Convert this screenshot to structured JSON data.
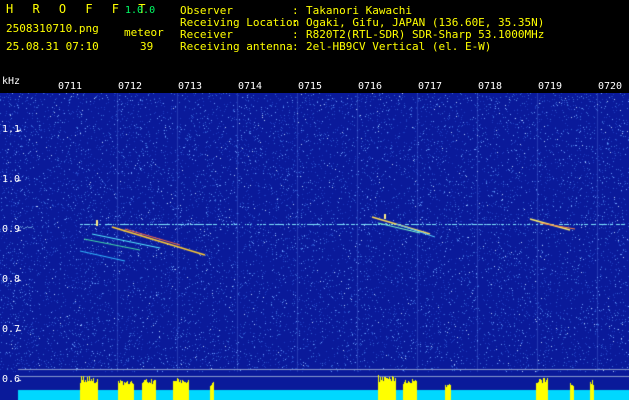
{
  "header": {
    "app_title": "H R O F F T",
    "app_version": "1.0.0",
    "filename": "2508310710.png",
    "datetime": "25.08.31 07:10",
    "meteor_label": "meteor",
    "meteor_count": "39",
    "info": [
      {
        "label": "Observer",
        "value": "Takanori Kawachi"
      },
      {
        "label": "Receiving Location",
        "value": "Ogaki, Gifu, JAPAN (136.60E, 35.35N)"
      },
      {
        "label": "Receiver",
        "value": "R820T2(RTL-SDR) SDR-Sharp 53.1000MHz"
      },
      {
        "label": "Receiving antenna",
        "value": "2el-HB9CV Vertical (el. E-W)"
      }
    ],
    "colon": ":"
  },
  "axis": {
    "y_unit": "kHz",
    "y_labels": [
      "1.1",
      "1.0",
      "0.9",
      "0.8",
      "0.7",
      "0.6"
    ],
    "time_labels": [
      "0711",
      "0712",
      "0713",
      "0714",
      "0715",
      "0716",
      "0717",
      "0718",
      "0719",
      "0720"
    ]
  },
  "colors": {
    "background": "#0a1a9a",
    "noise": "#3a6bd8",
    "trail": "#ffe85a",
    "carrier": "#7ee6ff",
    "text_yellow": "#ffff00",
    "text_white": "#ffffff",
    "text_green": "#00ff66",
    "bottom_bar": "#00d8ff",
    "meteor_peak": "#ffff00"
  }
}
